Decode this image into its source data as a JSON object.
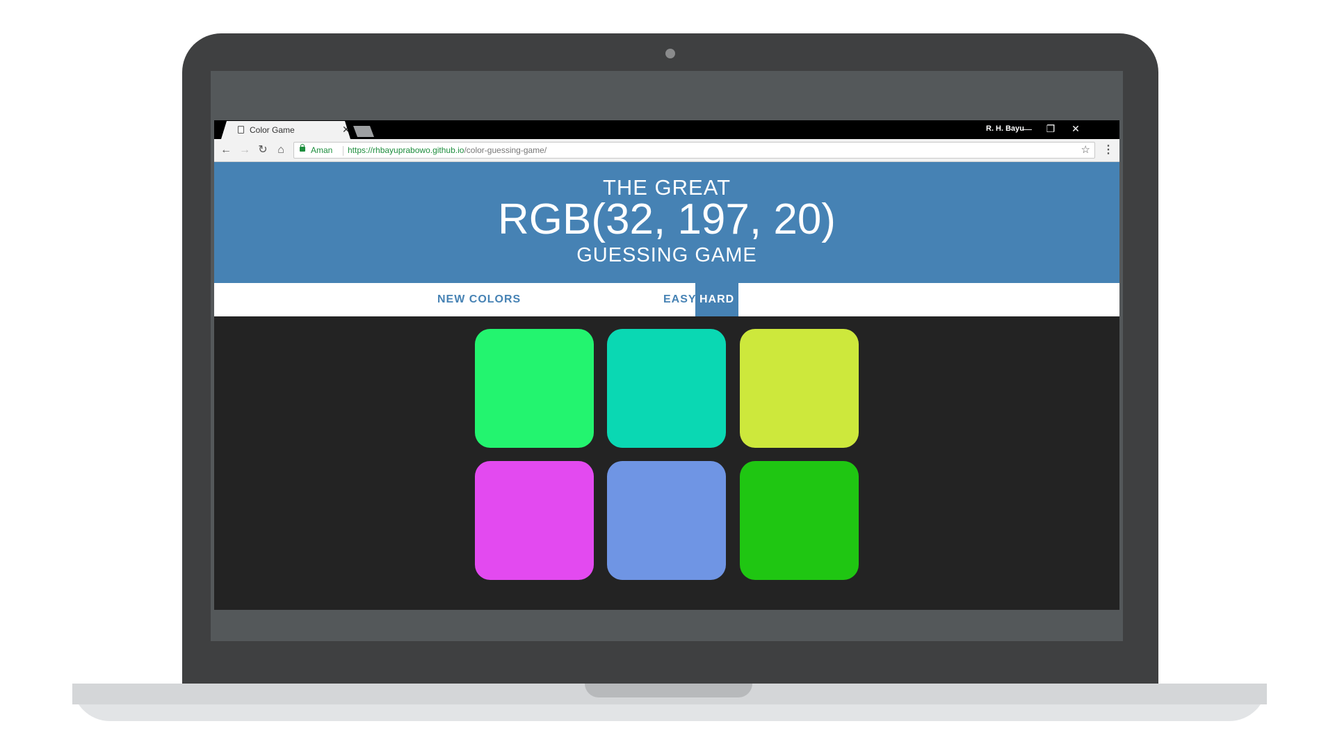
{
  "browser": {
    "tab_title": "Color Game",
    "tab_close": "✕",
    "profile_name": "R. H. Bayu",
    "window_controls": {
      "minimize": "—",
      "restore": "❐",
      "close": "✕"
    },
    "toolbar": {
      "back": "←",
      "forward": "→",
      "reload": "↻",
      "home": "⌂",
      "star": "☆",
      "menu": "⋮"
    },
    "secure_label": "Aman",
    "url_host": "https://rhbayuprabowo.github.io",
    "url_path": "/color-guessing-game/"
  },
  "game": {
    "title_line1": "THE GREAT",
    "target_color": "RGB(32, 197, 20)",
    "title_line3": "GUESSING GAME",
    "new_colors_label": "NEW COLORS",
    "mode_easy_label": "EASY",
    "mode_hard_label": "HARD",
    "selected_mode": "HARD",
    "squares": [
      {
        "color": "#23f46f"
      },
      {
        "color": "#0ad8b3"
      },
      {
        "color": "#cde83c"
      },
      {
        "color": "#e34af0"
      },
      {
        "color": "#6f95e4"
      },
      {
        "color": "#1fc612"
      }
    ]
  },
  "colors": {
    "header_bg": "#4682b4",
    "page_bg": "#232323",
    "secure_green": "#1e8e3e"
  }
}
